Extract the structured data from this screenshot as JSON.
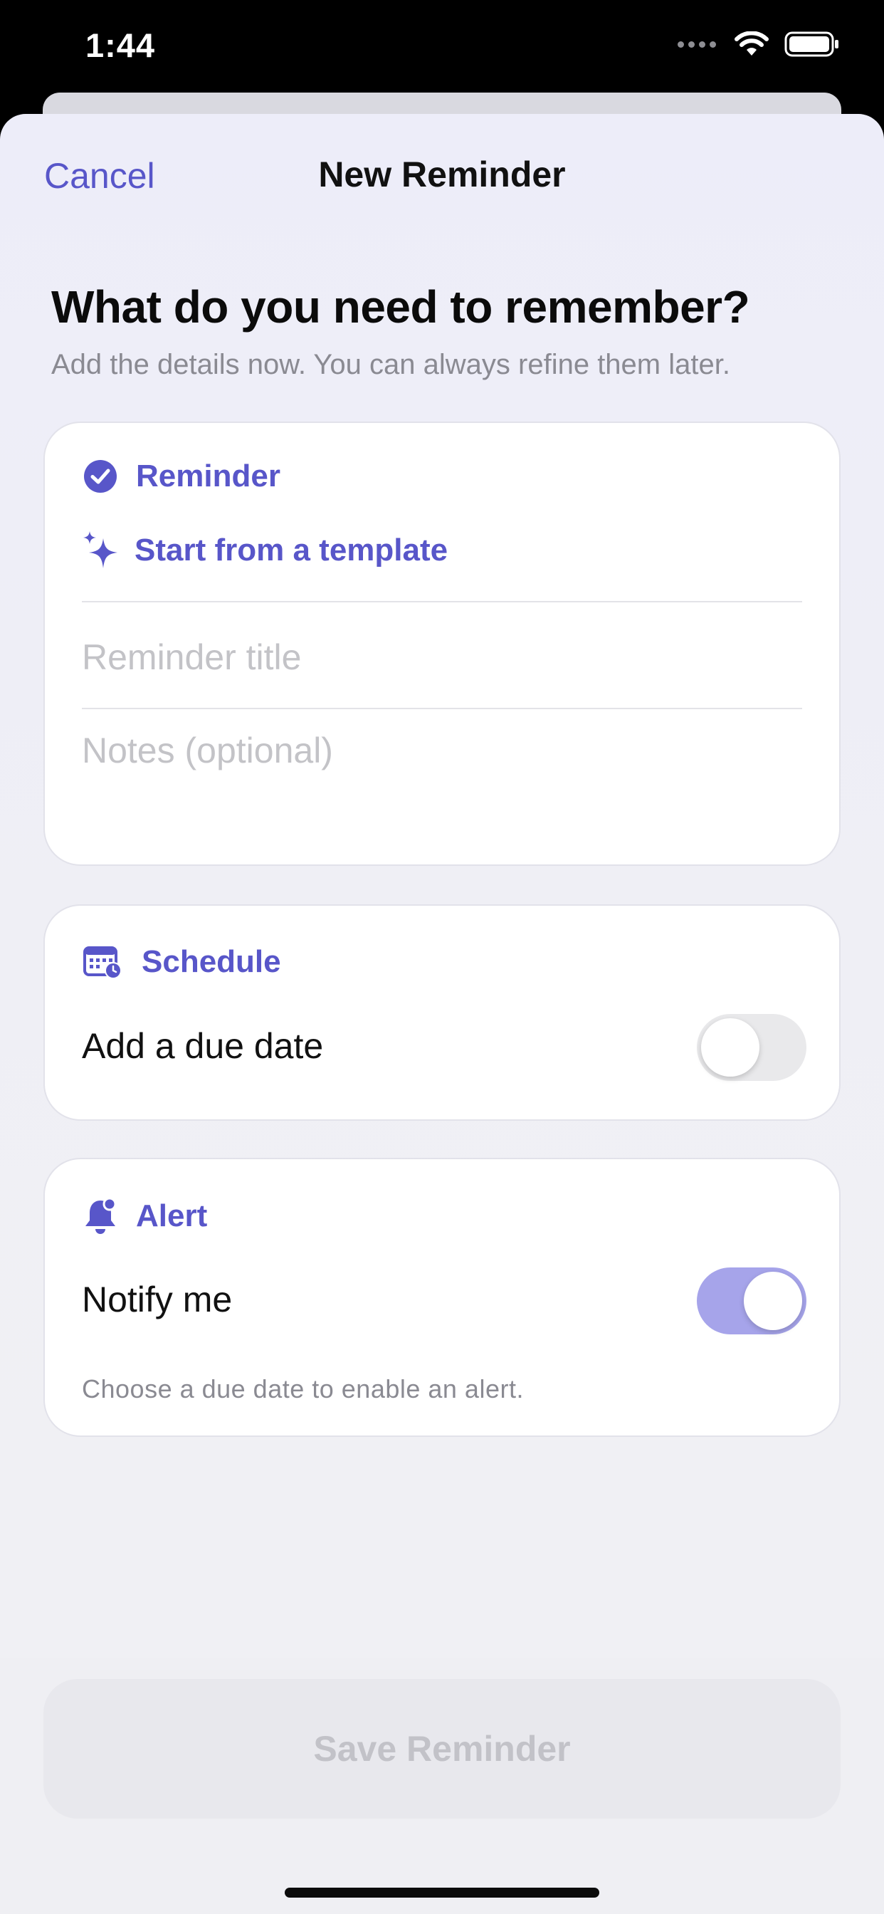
{
  "status_bar": {
    "time": "1:44",
    "icons": [
      "cellular-icon",
      "wifi-icon",
      "battery-icon"
    ]
  },
  "nav": {
    "cancel_label": "Cancel",
    "title": "New Reminder"
  },
  "header": {
    "title": "What do you need to remember?",
    "subtitle": "Add the details now. You can always refine them later."
  },
  "reminder_section": {
    "label": "Reminder",
    "icon": "checkmark-circle-icon",
    "template_label": "Start from a template",
    "template_icon": "sparkles-icon",
    "title_placeholder": "Reminder title",
    "title_value": "",
    "notes_placeholder": "Notes (optional)",
    "notes_value": ""
  },
  "schedule_section": {
    "label": "Schedule",
    "icon": "calendar-clock-icon",
    "due_date_label": "Add a due date",
    "due_date_enabled": false
  },
  "alert_section": {
    "label": "Alert",
    "icon": "bell-icon",
    "notify_label": "Notify me",
    "notify_enabled": true,
    "helper_text": "Choose a due date to enable an alert."
  },
  "footer": {
    "save_label": "Save Reminder"
  },
  "colors": {
    "accent": "#5856c9",
    "toggle_on": "#a6a4ea",
    "toggle_off": "#e9e9eb",
    "placeholder": "#c3c3c7",
    "secondary_text": "#8a8a92"
  }
}
